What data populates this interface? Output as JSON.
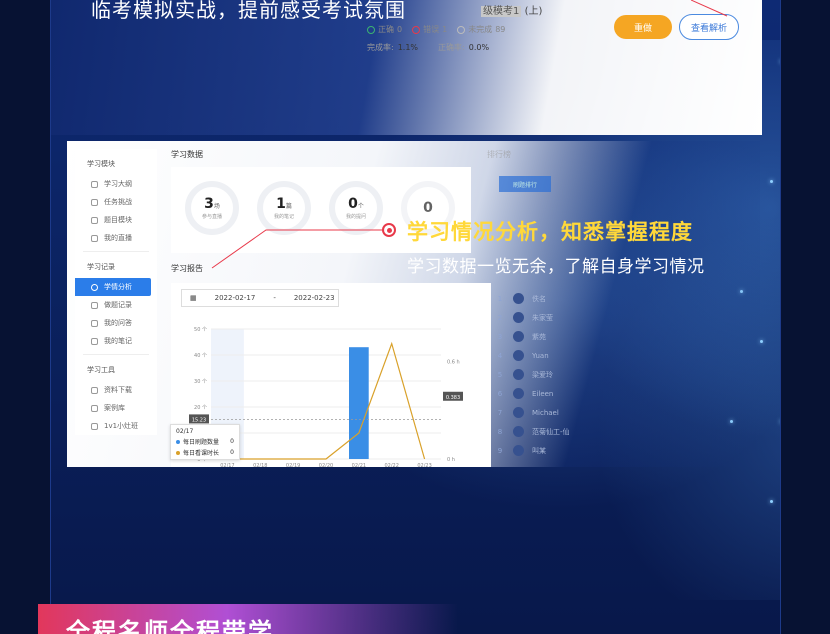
{
  "top": {
    "headline": "临考模拟实战，提前感受考试氛围",
    "exam_name_hl": "级模考1",
    "exam_name_rest": "(上)",
    "stats": [
      {
        "label": "正确",
        "value": "0",
        "color": "#3cb371"
      },
      {
        "label": "错误",
        "value": "1",
        "color": "#e8394a"
      },
      {
        "label": "未完成",
        "value": "89",
        "color": "#bbbbbb"
      }
    ],
    "rates": [
      {
        "label": "完成率:",
        "value": "1.1%"
      },
      {
        "label": "正确率:",
        "value": "0.0%"
      }
    ],
    "redo_label": "重做",
    "analysis_label": "查看解析"
  },
  "sidebar": {
    "groups": [
      {
        "title": "学习模块",
        "items": [
          "学习大纲",
          "任务挑战",
          "题目模块",
          "我的直播"
        ]
      },
      {
        "title": "学习记录",
        "items": [
          "学情分析",
          "做题记录",
          "我的问答",
          "我的笔记"
        ]
      },
      {
        "title": "学习工具",
        "items": [
          "资料下载",
          "案例库",
          "1v1小灶班"
        ]
      }
    ],
    "active_item": "学情分析"
  },
  "study_data": {
    "title": "学习数据",
    "cards": [
      {
        "num": "3",
        "unit": "场",
        "label": "参与直播"
      },
      {
        "num": "1",
        "unit": "篇",
        "label": "我的笔记"
      },
      {
        "num": "0",
        "unit": "个",
        "label": "我的提问"
      },
      {
        "num": "0",
        "unit": "",
        "label": ""
      }
    ]
  },
  "report": {
    "title": "学习报告",
    "start_date": "2022-02-17",
    "separator": "-",
    "end_date": "2022-02-23"
  },
  "chart_data": {
    "type": "bar",
    "categories": [
      "02/17",
      "02/18",
      "02/19",
      "02/20",
      "02/21",
      "02/22",
      "02/23"
    ],
    "series": [
      {
        "name": "每日刷题数量",
        "kind": "bar",
        "axis": "left",
        "values": [
          0,
          0,
          0,
          0,
          43,
          0,
          0
        ],
        "color": "#3a8ee6"
      },
      {
        "name": "每日看课时长",
        "kind": "line",
        "axis": "right",
        "values": [
          0,
          0,
          0,
          0,
          0.16,
          0.71,
          0
        ],
        "color": "#d9a12a"
      }
    ],
    "left_ticks": [
      "0 个",
      "10 个",
      "20 个",
      "30 个",
      "40 个",
      "50 个"
    ],
    "left_range": [
      0,
      50
    ],
    "right_ticks": [
      "0 h",
      "0.4 h",
      "0.6 h"
    ],
    "right_range": [
      0,
      0.8
    ],
    "avg_left_label": "15.23",
    "avg_right_label": "0.383",
    "avg_left": 15.23,
    "avg_right": 0.383
  },
  "tooltip": {
    "date": "02/17",
    "rows": [
      {
        "label": "每日刷题数量",
        "value": "0",
        "color": "#3a8ee6"
      },
      {
        "label": "每日看课时长",
        "value": "0",
        "color": "#d9a12a"
      }
    ]
  },
  "ranking": {
    "title": "排行榜",
    "tab": "刷题排行",
    "names": [
      "佚名",
      "朱家莹",
      "紫苑",
      "Yuan",
      "梁爱玲",
      "Eileen",
      "Michael",
      "范菊仙工-仙",
      "叫某"
    ]
  },
  "callout": {
    "title": "学习情况分析，知悉掌握程度",
    "subtitle": "学习数据一览无余，了解自身学习情况"
  },
  "banner": {
    "text": "全程名师全程带学"
  }
}
